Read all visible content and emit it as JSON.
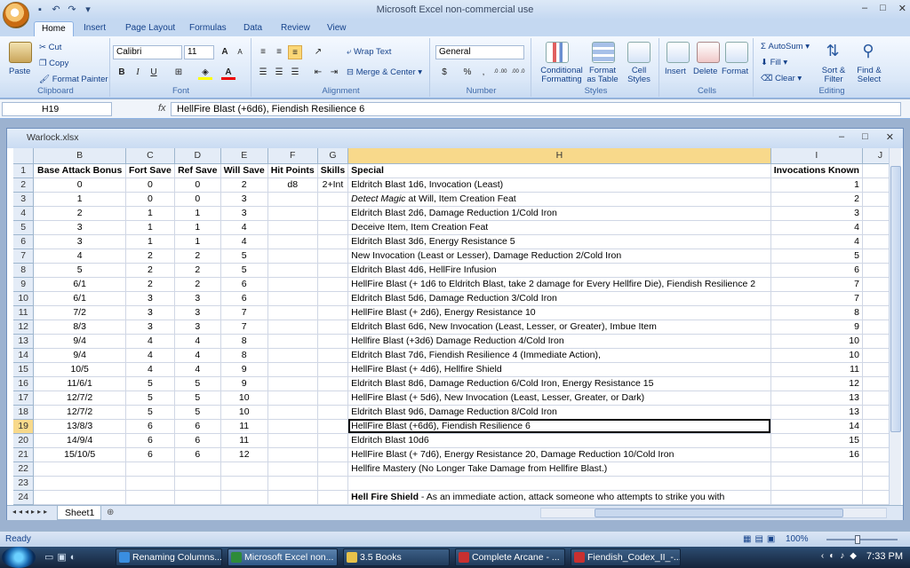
{
  "app": {
    "title": "Microsoft Excel non-commercial use",
    "window_buttons": [
      "–",
      "□",
      "✕"
    ]
  },
  "tabs": [
    "Home",
    "Insert",
    "Page Layout",
    "Formulas",
    "Data",
    "Review",
    "View"
  ],
  "ribbon": {
    "clipboard": {
      "paste": "Paste",
      "cut": "Cut",
      "copy": "Copy",
      "format_painter": "Format Painter",
      "label": "Clipboard"
    },
    "font": {
      "name": "Calibri",
      "size": "11",
      "grow": "A",
      "shrink": "A",
      "bold": "B",
      "italic": "I",
      "underline": "U",
      "label": "Font"
    },
    "alignment": {
      "wrap": "Wrap Text",
      "merge": "Merge & Center",
      "label": "Alignment"
    },
    "number": {
      "format": "General",
      "currency": "$",
      "percent": "%",
      "comma": ",",
      "inc_decimal": ".0 .00",
      "dec_decimal": ".00 .0",
      "label": "Number"
    },
    "styles": {
      "conditional": "Conditional Formatting",
      "as_table": "Format as Table",
      "cell_styles": "Cell Styles",
      "label": "Styles"
    },
    "cells": {
      "insert": "Insert",
      "delete": "Delete",
      "format": "Format",
      "label": "Cells"
    },
    "editing": {
      "autosum": "AutoSum",
      "fill": "Fill",
      "clear": "Clear",
      "sort": "Sort & Filter",
      "find": "Find & Select",
      "label": "Editing"
    }
  },
  "formula_bar": {
    "name_box": "H19",
    "fx": "fx",
    "value": "HellFire Blast (+6d6), Fiendish Resilience 6"
  },
  "workbook": {
    "title": "Warlock.xlsx",
    "buttons": [
      "–",
      "□",
      "✕"
    ]
  },
  "columns": [
    "B",
    "C",
    "D",
    "E",
    "F",
    "G",
    "H",
    "I",
    "J"
  ],
  "selected_row": 19,
  "rows": [
    {
      "n": "1",
      "B": "Base Attack Bonus",
      "C": "Fort Save",
      "D": "Ref Save",
      "E": "Will Save",
      "F": "Hit Points",
      "G": "Skills",
      "H": "Special",
      "I": "Invocations Known",
      "bold": true
    },
    {
      "n": "2",
      "B": "0",
      "C": "0",
      "D": "0",
      "E": "2",
      "F": "d8",
      "G": "2+Int",
      "H": "Eldritch Blast 1d6, Invocation (Least)",
      "I": "1"
    },
    {
      "n": "3",
      "B": "1",
      "C": "0",
      "D": "0",
      "E": "3",
      "F": "",
      "G": "",
      "H": "Detect Magic at Will, Item Creation Feat",
      "I": "2"
    },
    {
      "n": "4",
      "B": "2",
      "C": "1",
      "D": "1",
      "E": "3",
      "F": "",
      "G": "",
      "H": "Eldritch Blast 2d6, Damage Reduction 1/Cold Iron",
      "I": "3"
    },
    {
      "n": "5",
      "B": "3",
      "C": "1",
      "D": "1",
      "E": "4",
      "F": "",
      "G": "",
      "H": "Deceive Item, Item Creation Feat",
      "I": "4"
    },
    {
      "n": "6",
      "B": "3",
      "C": "1",
      "D": "1",
      "E": "4",
      "F": "",
      "G": "",
      "H": "Eldritch Blast 3d6, Energy Resistance 5",
      "I": "4"
    },
    {
      "n": "7",
      "B": "4",
      "C": "2",
      "D": "2",
      "E": "5",
      "F": "",
      "G": "",
      "H": "New Invocation (Least or Lesser), Damage Reduction 2/Cold Iron",
      "I": "5"
    },
    {
      "n": "8",
      "B": "5",
      "C": "2",
      "D": "2",
      "E": "5",
      "F": "",
      "G": "",
      "H": "Eldritch Blast 4d6, HellFire Infusion",
      "I": "6"
    },
    {
      "n": "9",
      "B": "6/1",
      "C": "2",
      "D": "2",
      "E": "6",
      "F": "",
      "G": "",
      "H": "HellFire Blast (+ 1d6 to Eldritch Blast, take 2 damage for Every Hellfire Die), Fiendish Resilience 2",
      "I": "7"
    },
    {
      "n": "10",
      "B": "6/1",
      "C": "3",
      "D": "3",
      "E": "6",
      "F": "",
      "G": "",
      "H": "Eldritch Blast 5d6, Damage Reduction 3/Cold Iron",
      "I": "7"
    },
    {
      "n": "11",
      "B": "7/2",
      "C": "3",
      "D": "3",
      "E": "7",
      "F": "",
      "G": "",
      "H": "HellFire Blast (+ 2d6), Energy Resistance 10",
      "I": "8"
    },
    {
      "n": "12",
      "B": "8/3",
      "C": "3",
      "D": "3",
      "E": "7",
      "F": "",
      "G": "",
      "H": "Eldritch Blast 6d6, New Invocation (Least, Lesser, or Greater), Imbue Item",
      "I": "9"
    },
    {
      "n": "13",
      "B": "9/4",
      "C": "4",
      "D": "4",
      "E": "8",
      "F": "",
      "G": "",
      "H": "Hellfire Blast (+3d6) Damage Reduction 4/Cold Iron",
      "I": "10"
    },
    {
      "n": "14",
      "B": "9/4",
      "C": "4",
      "D": "4",
      "E": "8",
      "F": "",
      "G": "",
      "H": "Eldritch Blast 7d6, Fiendish Resilience 4 (Immediate Action),",
      "I": "10"
    },
    {
      "n": "15",
      "B": "10/5",
      "C": "4",
      "D": "4",
      "E": "9",
      "F": "",
      "G": "",
      "H": "HellFire Blast (+ 4d6), Hellfire Shield",
      "I": "11"
    },
    {
      "n": "16",
      "B": "11/6/1",
      "C": "5",
      "D": "5",
      "E": "9",
      "F": "",
      "G": "",
      "H": "Eldritch Blast 8d6, Damage Reduction 6/Cold Iron, Energy Resistance 15",
      "I": "12"
    },
    {
      "n": "17",
      "B": "12/7/2",
      "C": "5",
      "D": "5",
      "E": "10",
      "F": "",
      "G": "",
      "H": "HellFire Blast (+ 5d6), New Invocation (Least, Lesser, Greater, or Dark)",
      "I": "13"
    },
    {
      "n": "18",
      "B": "12/7/2",
      "C": "5",
      "D": "5",
      "E": "10",
      "F": "",
      "G": "",
      "H": "Eldritch Blast 9d6, Damage Reduction 8/Cold Iron",
      "I": "13"
    },
    {
      "n": "19",
      "B": "13/8/3",
      "C": "6",
      "D": "6",
      "E": "11",
      "F": "",
      "G": "",
      "H": "HellFire Blast (+6d6), Fiendish Resilience 6",
      "I": "14"
    },
    {
      "n": "20",
      "B": "14/9/4",
      "C": "6",
      "D": "6",
      "E": "11",
      "F": "",
      "G": "",
      "H": "Eldritch Blast 10d6",
      "I": "15"
    },
    {
      "n": "21",
      "B": "15/10/5",
      "C": "6",
      "D": "6",
      "E": "12",
      "F": "",
      "G": "",
      "H": "HellFire Blast (+ 7d6), Energy Resistance 20, Damage Reduction 10/Cold Iron",
      "I": "16"
    },
    {
      "n": "22",
      "B": "",
      "C": "",
      "D": "",
      "E": "",
      "F": "",
      "G": "",
      "H": "Hellfire Mastery (No Longer Take Damage from Hellfire Blast.)",
      "I": ""
    },
    {
      "n": "23",
      "B": "",
      "C": "",
      "D": "",
      "E": "",
      "F": "",
      "G": "",
      "H": "",
      "I": ""
    },
    {
      "n": "24",
      "B": "",
      "C": "",
      "D": "",
      "E": "",
      "F": "",
      "G": "",
      "H": "Hell Fire Shield - As an immediate action, attack someone who attempts to strike you with",
      "I": ""
    }
  ],
  "sheet_tab": "Sheet1",
  "status": {
    "ready": "Ready",
    "zoom": "100%"
  },
  "taskbar": {
    "items": [
      "Renaming Columns...",
      "Microsoft Excel non...",
      "3.5 Books",
      "Complete Arcane - ...",
      "Fiendish_Codex_II_-..."
    ],
    "clock": "7:33 PM"
  }
}
